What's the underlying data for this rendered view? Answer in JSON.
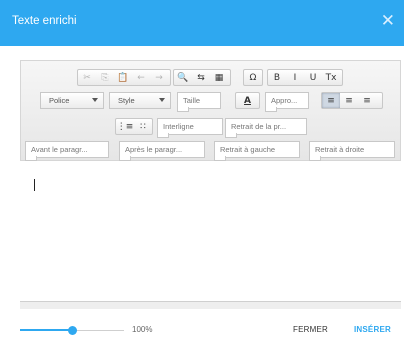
{
  "dialog": {
    "title": "Texte enrichi",
    "close_glyph": "✕"
  },
  "toolbar": {
    "row1_group1": [
      {
        "name": "cut-icon",
        "glyph": "✂",
        "disabled": true
      },
      {
        "name": "copy-icon",
        "glyph": "⎘",
        "disabled": true
      },
      {
        "name": "paste-icon",
        "glyph": "📋",
        "disabled": false
      },
      {
        "name": "undo-icon",
        "glyph": "←",
        "disabled": true
      },
      {
        "name": "redo-icon",
        "glyph": "→",
        "disabled": true
      }
    ],
    "row1_group2": [
      {
        "name": "search-icon",
        "glyph": "🔍",
        "disabled": false
      },
      {
        "name": "replace-icon",
        "glyph": "⇆",
        "disabled": false
      },
      {
        "name": "table-icon",
        "glyph": "▦",
        "disabled": false
      }
    ],
    "row1_group3": [
      {
        "name": "special-char-icon",
        "glyph": "Ω",
        "disabled": false
      }
    ],
    "row1_group4": [
      {
        "name": "bold-icon",
        "glyph": "B",
        "disabled": false
      },
      {
        "name": "italic-icon",
        "glyph": "I",
        "disabled": false
      },
      {
        "name": "underline-icon",
        "glyph": "U",
        "disabled": false
      },
      {
        "name": "clear-format-icon",
        "glyph": "Tx",
        "disabled": false
      }
    ],
    "font_dropdown": "Police",
    "style_dropdown": "Style",
    "size_field": "Taille",
    "text_color_glyph": "A",
    "appearance_field": "Appro...",
    "align_group": [
      {
        "name": "align-left-icon",
        "glyph": "≡",
        "active": true
      },
      {
        "name": "align-center-icon",
        "glyph": "≡",
        "active": false
      },
      {
        "name": "align-right-icon",
        "glyph": "≡",
        "active": false
      }
    ],
    "list_group": [
      {
        "name": "ordered-list-icon",
        "glyph": "⋮≡"
      },
      {
        "name": "bullet-list-icon",
        "glyph": "∷"
      }
    ],
    "line_spacing_field": "Interligne",
    "first_indent_field": "Retrait de la pr...",
    "space_before_field": "Avant le paragr...",
    "space_after_field": "Après le paragr...",
    "indent_left_field": "Retrait à gauche",
    "indent_right_field": "Retrait à droite"
  },
  "footer": {
    "zoom_label": "100%",
    "zoom_fraction": 0.5,
    "fermer_label": "FERMER",
    "inserer_label": "INSÉRER"
  },
  "colors": {
    "accent": "#2ea8f0"
  }
}
